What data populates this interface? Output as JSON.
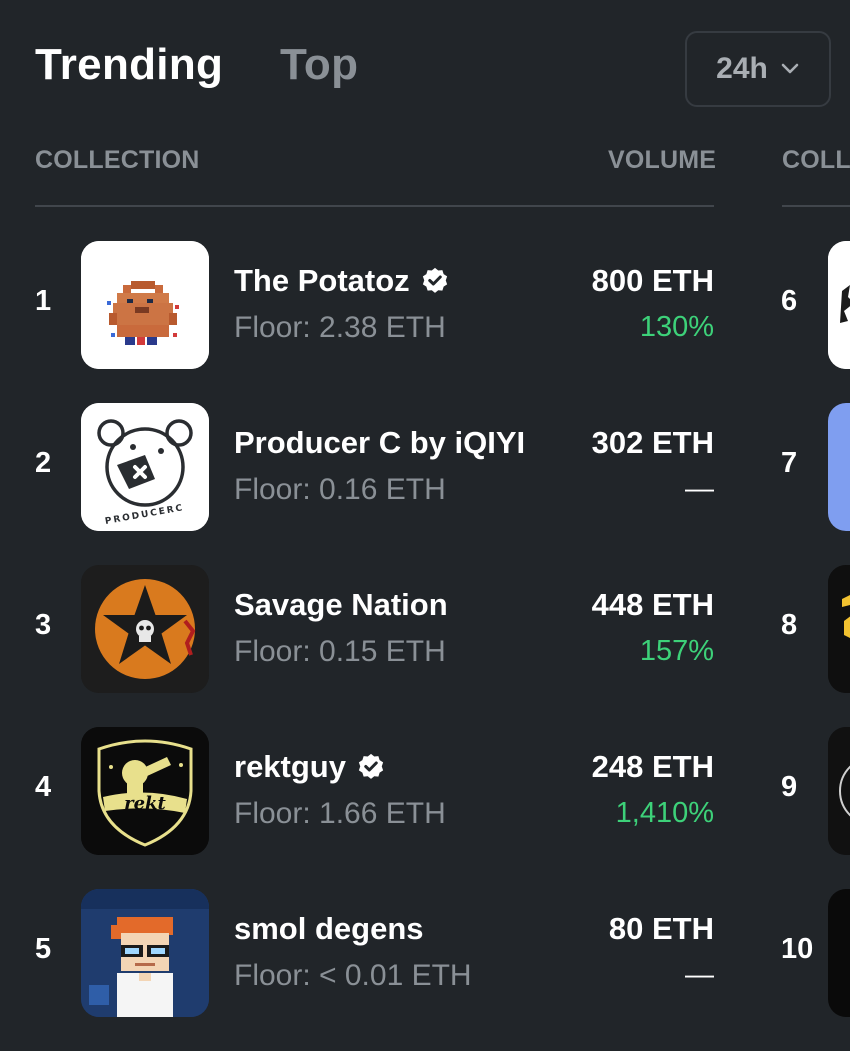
{
  "tabs": {
    "trending": "Trending",
    "top": "Top"
  },
  "period": {
    "selected": "24h"
  },
  "columns": {
    "collection": "COLLECTION",
    "volume": "VOLUME",
    "collection_right": "COLL"
  },
  "rows": [
    {
      "rank": "1",
      "name": "The Potatoz",
      "verified": true,
      "floor": "Floor: 2.38 ETH",
      "volume": "800 ETH",
      "change": "130%"
    },
    {
      "rank": "2",
      "name": "Producer C by iQIYI",
      "verified": false,
      "floor": "Floor: 0.16 ETH",
      "volume": "302 ETH",
      "change": "—"
    },
    {
      "rank": "3",
      "name": "Savage Nation",
      "verified": false,
      "floor": "Floor: 0.15 ETH",
      "volume": "448 ETH",
      "change": "157%"
    },
    {
      "rank": "4",
      "name": "rektguy",
      "verified": true,
      "floor": "Floor: 1.66 ETH",
      "volume": "248 ETH",
      "change": "1,410%"
    },
    {
      "rank": "5",
      "name": "smol degens",
      "verified": false,
      "floor": "Floor: < 0.01 ETH",
      "volume": "80 ETH",
      "change": "—"
    }
  ],
  "right_ranks": [
    "6",
    "7",
    "8",
    "9",
    "10"
  ],
  "logos": {
    "producer_c_text": "PRODUCERC",
    "rektguy_text": "rekt"
  },
  "colors": {
    "background": "#212529",
    "positive": "#3dd179",
    "muted": "#8a9096"
  },
  "icons": {
    "verified": "verified-badge-icon",
    "dropdown": "chevron-down-icon"
  }
}
